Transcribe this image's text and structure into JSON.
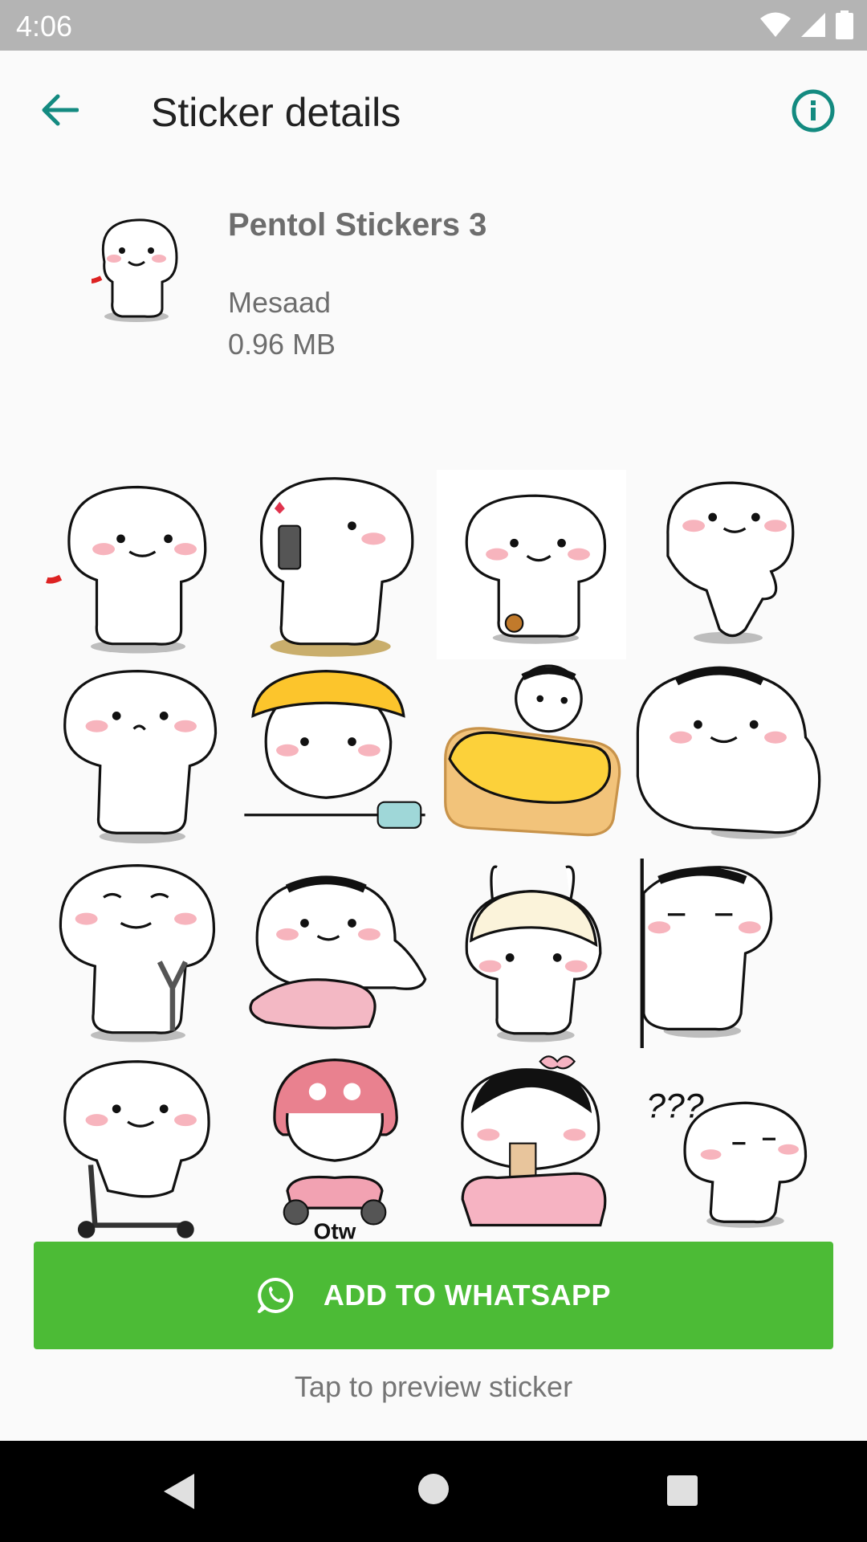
{
  "status_bar": {
    "time": "4:06",
    "icons": [
      "wifi-icon",
      "signal-icon",
      "battery-icon"
    ]
  },
  "app_bar": {
    "title": "Sticker details",
    "back_icon": "arrow-back-icon",
    "info_icon": "info-icon",
    "accent_color": "#138a80"
  },
  "pack": {
    "name": "Pentol Stickers 3",
    "publisher": "Mesaad",
    "size": "0.96 MB"
  },
  "stickers": [
    {
      "id": "peace-sign"
    },
    {
      "id": "phone-call"
    },
    {
      "id": "cookie"
    },
    {
      "id": "dance"
    },
    {
      "id": "confused"
    },
    {
      "id": "helmet-phone"
    },
    {
      "id": "bread-bed"
    },
    {
      "id": "lying-down"
    },
    {
      "id": "slingshot"
    },
    {
      "id": "pillow"
    },
    {
      "id": "bunny-hat"
    },
    {
      "id": "peek"
    },
    {
      "id": "scooter"
    },
    {
      "id": "motorbike",
      "caption": "Otw"
    },
    {
      "id": "bubble-tea"
    },
    {
      "id": "question"
    }
  ],
  "actions": {
    "add_label": "ADD TO WHATSAPP",
    "add_icon": "whatsapp-icon",
    "add_color": "#4cbb36",
    "hint": "Tap to preview sticker"
  },
  "nav_bar": {
    "back": "nav-back-icon",
    "home": "nav-home-icon",
    "recents": "nav-recents-icon"
  }
}
